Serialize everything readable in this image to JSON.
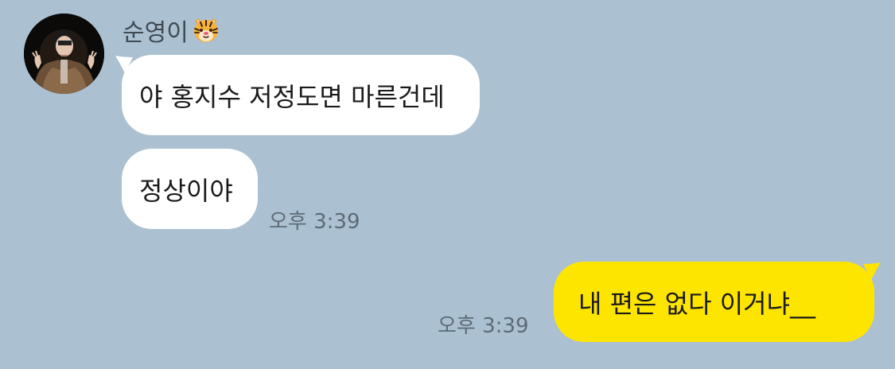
{
  "conversation": {
    "sender": {
      "name": "순영이",
      "emoji_icon": "tiger-face-icon",
      "avatar_icon": "profile-photo-avatar"
    },
    "messages": [
      {
        "direction": "incoming",
        "text": "야 홍지수 저정도면 마른건데"
      },
      {
        "direction": "incoming",
        "text": "정상이야",
        "time": "오후 3:39"
      },
      {
        "direction": "outgoing",
        "text": "내 편은 없다 이거냐__",
        "time": "오후 3:39"
      }
    ]
  },
  "colors": {
    "background": "#abc1d1",
    "incoming_bubble": "#ffffff",
    "outgoing_bubble": "#fee500",
    "time_text": "#5d6b76",
    "name_text": "#3f4a52"
  }
}
